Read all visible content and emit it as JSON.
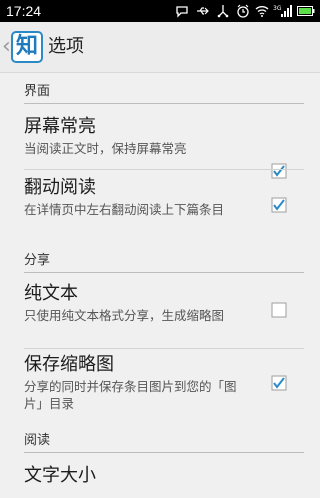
{
  "statusbar": {
    "time": "17:24",
    "icons": [
      "chat-icon",
      "usb-icon",
      "alarm-icon",
      "wifi-icon",
      "signal-3g-icon",
      "battery-icon"
    ],
    "signal_label": "3G"
  },
  "actionbar": {
    "logo_text": "知",
    "title": "选项"
  },
  "sections": {
    "ui": {
      "header": "界面",
      "items": [
        {
          "title": "屏幕常亮",
          "summary": "当阅读正文时，保持屏幕常亮",
          "checked": true
        },
        {
          "title": "翻动阅读",
          "summary": "在详情页中左右翻动阅读上下篇条目",
          "checked": true
        }
      ]
    },
    "share": {
      "header": "分享",
      "items": [
        {
          "title": "纯文本",
          "summary": "只使用纯文本格式分享，生成缩略图",
          "checked": false
        },
        {
          "title": "保存缩略图",
          "summary": "分享的同时并保存条目图片到您的「图片」目录",
          "checked": true
        }
      ]
    },
    "read": {
      "header": "阅读",
      "items": [
        {
          "title": "文字大小"
        }
      ]
    }
  },
  "colors": {
    "accent": "#2a8ac6",
    "checkbox_border": "#9e9e9e",
    "checkmark": "#2a8ac6"
  }
}
